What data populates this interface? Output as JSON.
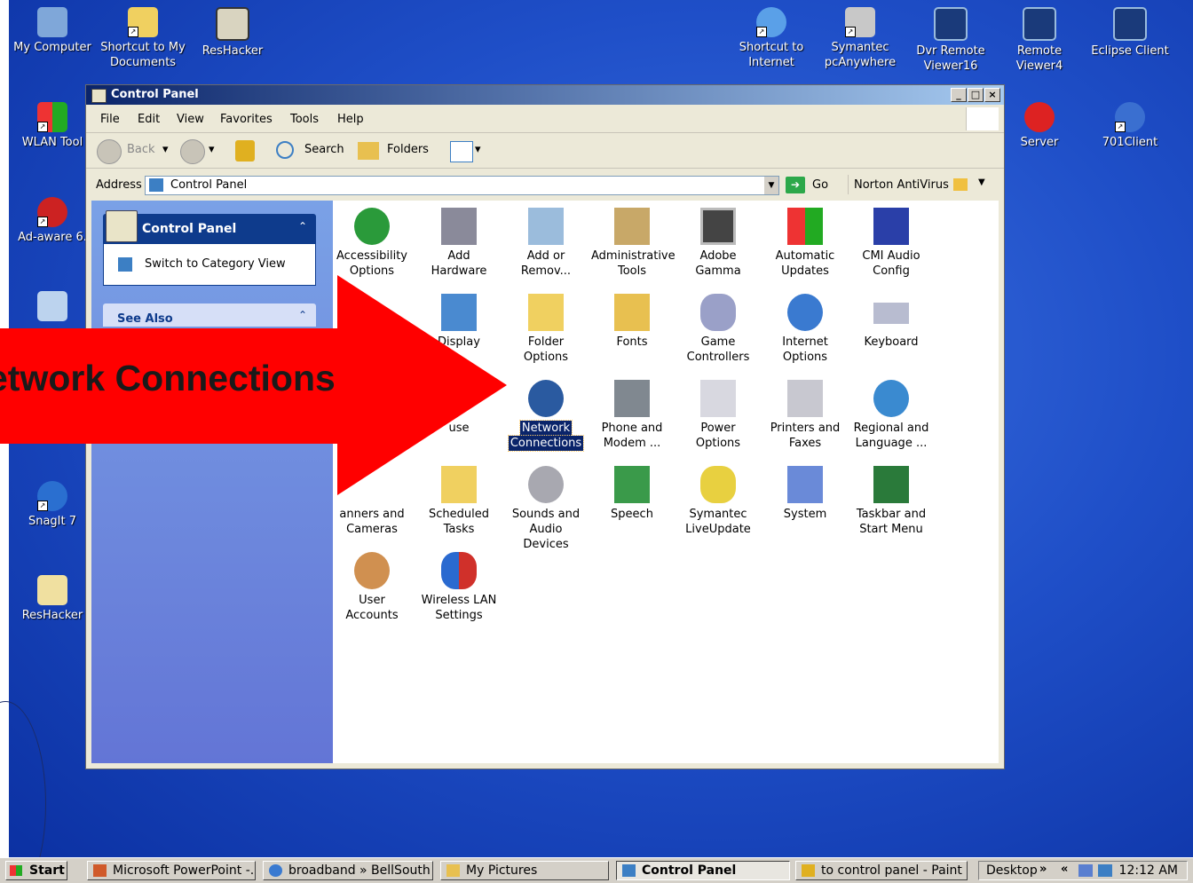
{
  "desktop_icons": {
    "my_computer": "My Computer",
    "shortcut_my_documents": [
      "Shortcut to My",
      "Documents"
    ],
    "reshacker_top": "ResHacker",
    "shortcut_internet": [
      "Shortcut to",
      "Internet"
    ],
    "symantec_pcanywhere": [
      "Symantec",
      "pcAnywhere"
    ],
    "dvr_remote_viewer16": [
      "Dvr Remote",
      "Viewer16"
    ],
    "remote_viewer4": [
      "Remote",
      "Viewer4"
    ],
    "eclipse_client": "Eclipse Client",
    "wlan_tool": "WLAN Tool",
    "server": "Server",
    "client701": "701Client",
    "adaware": "Ad-aware 6.",
    "snagit": "SnagIt 7",
    "reshacker_left": "ResHacker"
  },
  "window": {
    "title": "Control Panel",
    "controls": {
      "minimize": "_",
      "maximize": "□",
      "close": "×"
    }
  },
  "menu": [
    "File",
    "Edit",
    "View",
    "Favorites",
    "Tools",
    "Help"
  ],
  "toolbar": {
    "back": "Back",
    "search": "Search",
    "folders": "Folders"
  },
  "address": {
    "label": "Address",
    "value": "Control Panel",
    "go": "Go",
    "norton": "Norton AntiVirus"
  },
  "task_pane": {
    "header": "Control Panel",
    "switch_view": "Switch to Category View",
    "see_also": "See Also"
  },
  "cp_items": [
    [
      "Accessibility",
      "Options"
    ],
    [
      "Add Hardware",
      ""
    ],
    [
      "Add or",
      "Remov..."
    ],
    [
      "Administrative",
      "Tools"
    ],
    [
      "Adobe Gamma",
      ""
    ],
    [
      "Automatic",
      "Updates"
    ],
    [
      "CMI Audio",
      "Config"
    ],
    [
      "Display",
      ""
    ],
    [
      "Folder Options",
      ""
    ],
    [
      "Fonts",
      ""
    ],
    [
      "Game",
      "Controllers"
    ],
    [
      "Internet",
      "Options"
    ],
    [
      "Keyboard",
      ""
    ],
    [
      "use",
      ""
    ],
    [
      "Network",
      "Connections"
    ],
    [
      "Phone and",
      "Modem ..."
    ],
    [
      "Power Options",
      ""
    ],
    [
      "Printers and",
      "Faxes"
    ],
    [
      "Regional and",
      "Language ..."
    ],
    [
      "anners and",
      "Cameras"
    ],
    [
      "Scheduled",
      "Tasks"
    ],
    [
      "Sounds and",
      "Audio Devices"
    ],
    [
      "Speech",
      ""
    ],
    [
      "Symantec",
      "LiveUpdate"
    ],
    [
      "System",
      ""
    ],
    [
      "Taskbar and",
      "Start Menu"
    ],
    [
      "User Accounts",
      ""
    ],
    [
      "Wireless LAN",
      "Settings"
    ]
  ],
  "callout": {
    "text": "etwork Connections",
    "color": "#ff0000"
  },
  "taskbar": {
    "start": "Start",
    "tasks": [
      "Microsoft PowerPoint -...",
      "broadband » BellSouth ...",
      "My Pictures",
      "Control Panel",
      "to control panel - Paint"
    ],
    "desktop": "Desktop",
    "chevron": "»",
    "chevron2": "«",
    "clock": "12:12 AM"
  },
  "colors": {
    "desktop": "#1f4fc8",
    "title_bar": "#0a246a",
    "selection": "#0a246a",
    "arrow": "#ff0000"
  }
}
